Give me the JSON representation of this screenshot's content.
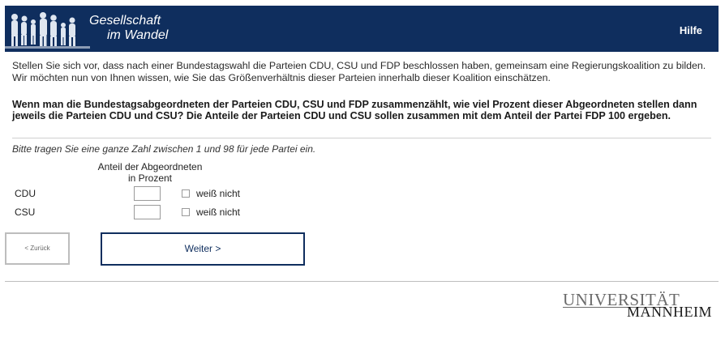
{
  "header": {
    "logo_line1": "Gesellschaft",
    "logo_line2": "im Wandel",
    "help_label": "Hilfe",
    "bg_color": "#0f2e5e"
  },
  "intro": "Stellen Sie sich vor, dass nach einer Bundestagswahl die Parteien CDU, CSU und FDP beschlossen haben, gemeinsam eine Regierungskoalition zu bilden. Wir möchten nun von Ihnen wissen, wie Sie das Größenverhältnis dieser Parteien innerhalb dieser Koalition einschätzen.",
  "question": "Wenn man die Bundestagsabgeordneten der Parteien CDU, CSU und FDP zusammenzählt, wie viel Prozent dieser Abgeordneten stellen dann jeweils die Parteien CDU und CSU? Die Anteile der Parteien CDU und CSU sollen zusammen mit dem Anteil der Partei FDP 100 ergeben.",
  "instruction": "Bitte tragen Sie eine ganze Zahl zwischen 1 und 98 für jede Partei ein.",
  "column_header_line1": "Anteil der Abgeordneten",
  "column_header_line2": "in Prozent",
  "rows": [
    {
      "label": "CDU",
      "value": "",
      "dont_know": "weiß nicht"
    },
    {
      "label": "CSU",
      "value": "",
      "dont_know": "weiß nicht"
    }
  ],
  "buttons": {
    "back": "< Zurück",
    "next": "Weiter >"
  },
  "footer": {
    "uni_line1": "UNIVERSITÄT",
    "uni_line2": "MANNHEIM"
  }
}
